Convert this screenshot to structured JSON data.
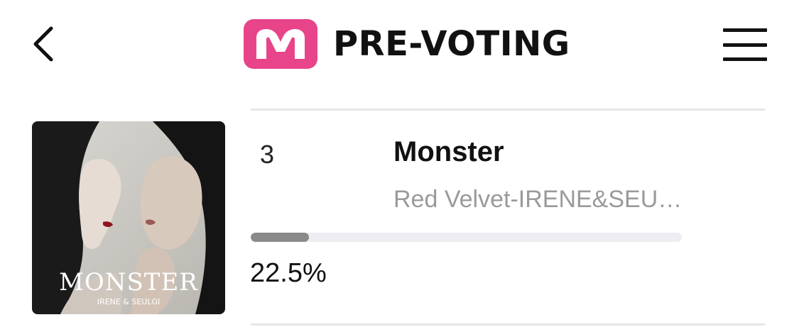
{
  "header": {
    "back_icon": "chevron-left-icon",
    "logo_letter": "M",
    "title": "PRE-VOTING",
    "menu_icon": "hamburger-menu-icon",
    "brand_color": "#e8448a"
  },
  "entry": {
    "rank": "3",
    "title": "Monster",
    "artist": "Red Velvet-IRENE&SEU…",
    "percent_text": "22.5%",
    "progress_fraction": 0.225,
    "cover": {
      "title": "MONSTER",
      "subtitle": "IRENE  &  SEULGI"
    }
  }
}
